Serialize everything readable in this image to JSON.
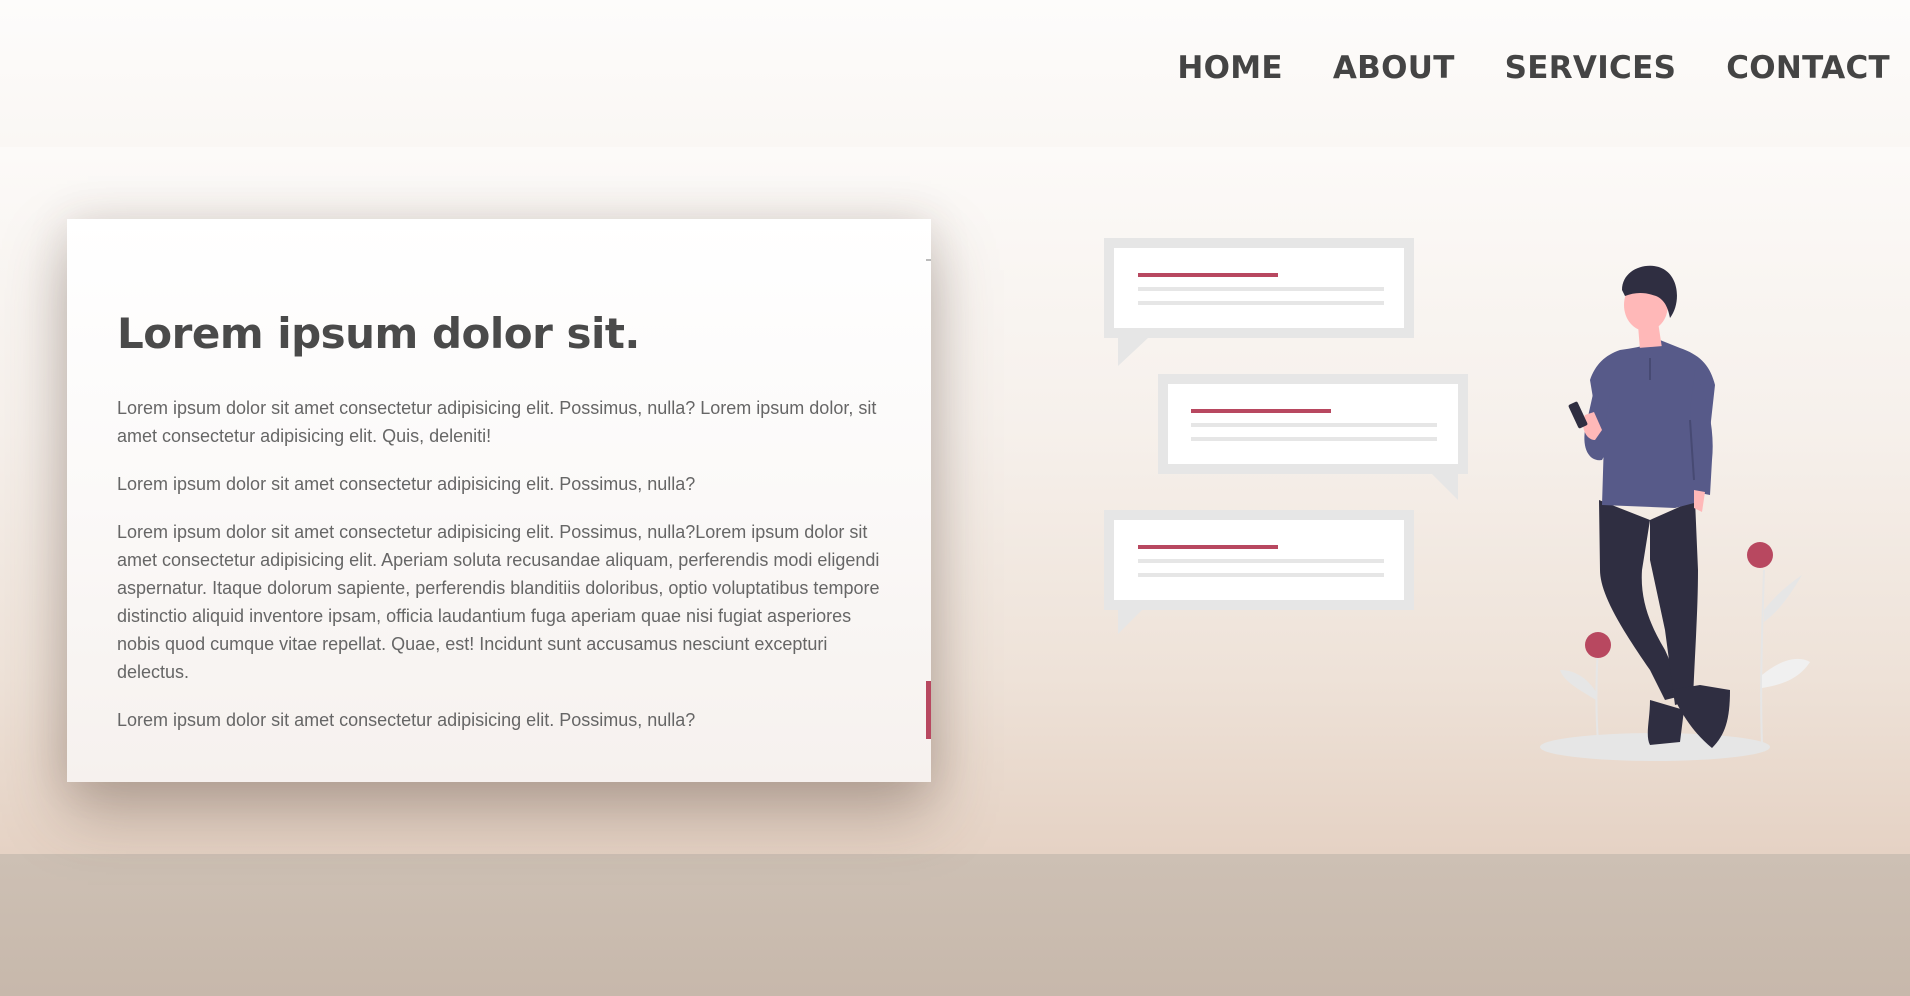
{
  "nav": {
    "items": [
      {
        "label": "HOME"
      },
      {
        "label": "ABOUT"
      },
      {
        "label": "SERVICES"
      },
      {
        "label": "CONTACT"
      }
    ]
  },
  "card": {
    "title": "Lorem ipsum dolor sit.",
    "paragraphs": [
      "Lorem ipsum dolor sit amet consectetur adipisicing elit. Possimus, nulla? Lorem ipsum dolor, sit amet consectetur adipisicing elit. Quis, deleniti!",
      "Lorem ipsum dolor sit amet consectetur adipisicing elit. Possimus, nulla?",
      "Lorem ipsum dolor sit amet consectetur adipisicing elit. Possimus, nulla?Lorem ipsum dolor sit amet consectetur adipisicing elit. Aperiam soluta recusandae aliquam, perferendis modi eligendi aspernatur. Itaque dolorum sapiente, perferendis blanditiis doloribus, optio voluptatibus tempore distinctio aliquid inventore ipsam, officia laudantium fuga aperiam quae nisi fugiat asperiores nobis quod cumque vitae repellat. Quae, est! Incidunt sunt accusamus nesciunt excepturi delectus.",
      "Lorem ipsum dolor sit amet consectetur adipisicing elit. Possimus, nulla?"
    ]
  },
  "illustration": {
    "name": "chat-person-illustration",
    "colors": {
      "accent": "#b84860",
      "bubble_border": "#e6e6e6",
      "shirt": "#575a89",
      "pants": "#2f2e41",
      "skin": "#ffb8b8",
      "hair": "#2f2e41"
    }
  },
  "colors": {
    "text_dark": "#444444",
    "text_body": "#666666",
    "accent": "#b84860"
  }
}
